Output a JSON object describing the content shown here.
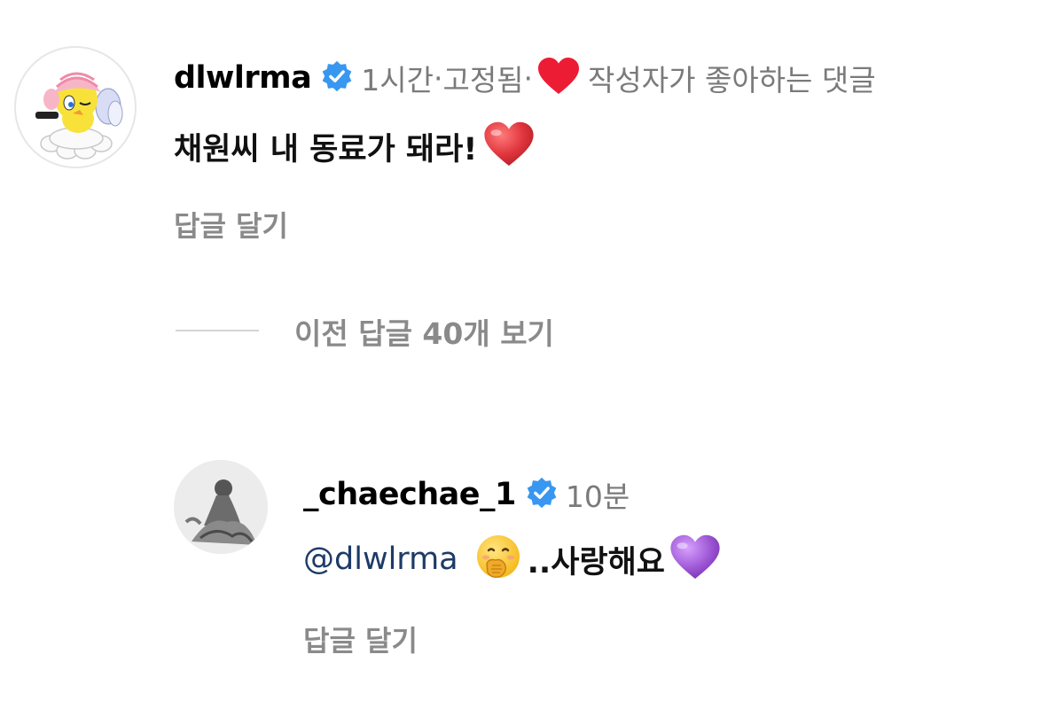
{
  "comment": {
    "username": "dlwlrma",
    "time": "1시간",
    "sep1": " · ",
    "pinned": "고정됨",
    "sep2": " · ",
    "liked_by_author": "작성자가 좋아하는 댓글",
    "text": "채원씨 내 동료가 돼라!",
    "reply_label": "답글 달기"
  },
  "view_replies": {
    "text": "이전 답글 40개 보기"
  },
  "reply": {
    "username": "_chaechae_1",
    "time": "10분",
    "mention": "@dlwlrma",
    "text": "..사랑해요",
    "reply_label": "답글 달기"
  },
  "colors": {
    "verified_badge": "#3897f0",
    "liked_heart": "#ed1c35",
    "red_heart_emoji": "#e0353d",
    "purple_heart_emoji": "#a05ad6",
    "mention": "#1d3b67",
    "muted_text": "#8a8a8a"
  },
  "icons": {
    "verified": "verified-badge-icon",
    "liked": "heart-icon",
    "emoji_red_heart": "red-heart-emoji-icon",
    "emoji_face": "face-with-hand-over-mouth-emoji-icon",
    "emoji_purple_heart": "purple-heart-emoji-icon"
  }
}
